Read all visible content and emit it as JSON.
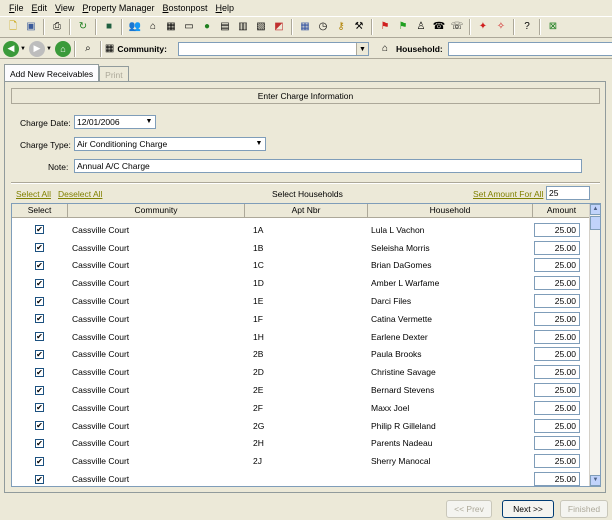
{
  "menu": [
    "File",
    "Edit",
    "View",
    "Property Manager",
    "Bostonpost",
    "Help"
  ],
  "nav": {
    "community_label": "Community:",
    "community_value": "",
    "household_label": "Household:",
    "household_value": ""
  },
  "tabs": [
    {
      "label": "Add New Receivables"
    },
    {
      "label": "Print"
    }
  ],
  "form": {
    "header": "Enter Charge Information",
    "charge_date_label": "Charge Date:",
    "charge_date": "12/01/2006",
    "charge_type_label": "Charge Type:",
    "charge_type": "Air Conditioning Charge",
    "note_label": "Note:",
    "note": "Annual A/C Charge"
  },
  "selection": {
    "select_all": "Select All",
    "deselect_all": "Deselect All",
    "title": "Select Households",
    "set_amount_label": "Set Amount For All",
    "set_amount_value": "25"
  },
  "table": {
    "headers": [
      "Select",
      "Community",
      "Apt Nbr",
      "Household",
      "Amount"
    ],
    "rows": [
      {
        "checked": true,
        "community": "Cassville Court",
        "apt": "1A",
        "household": "Lula L Vachon",
        "amount": "25.00"
      },
      {
        "checked": true,
        "community": "Cassville Court",
        "apt": "1B",
        "household": "Seleisha Morris",
        "amount": "25.00"
      },
      {
        "checked": true,
        "community": "Cassville Court",
        "apt": "1C",
        "household": "Brian DaGomes",
        "amount": "25.00"
      },
      {
        "checked": true,
        "community": "Cassville Court",
        "apt": "1D",
        "household": "Amber L Warfame",
        "amount": "25.00"
      },
      {
        "checked": true,
        "community": "Cassville Court",
        "apt": "1E",
        "household": "Darci Files",
        "amount": "25.00"
      },
      {
        "checked": true,
        "community": "Cassville Court",
        "apt": "1F",
        "household": "Catina Vermette",
        "amount": "25.00"
      },
      {
        "checked": true,
        "community": "Cassville Court",
        "apt": "1H",
        "household": "Earlene Dexter",
        "amount": "25.00"
      },
      {
        "checked": true,
        "community": "Cassville Court",
        "apt": "2B",
        "household": "Paula Brooks",
        "amount": "25.00"
      },
      {
        "checked": true,
        "community": "Cassville Court",
        "apt": "2D",
        "household": "Christine Savage",
        "amount": "25.00"
      },
      {
        "checked": true,
        "community": "Cassville Court",
        "apt": "2E",
        "household": "Bernard Stevens",
        "amount": "25.00"
      },
      {
        "checked": true,
        "community": "Cassville Court",
        "apt": "2F",
        "household": "Maxx Joel",
        "amount": "25.00"
      },
      {
        "checked": true,
        "community": "Cassville Court",
        "apt": "2G",
        "household": "Philip R Gilleland",
        "amount": "25.00"
      },
      {
        "checked": true,
        "community": "Cassville Court",
        "apt": "2H",
        "household": "Parents Nadeau",
        "amount": "25.00"
      },
      {
        "checked": true,
        "community": "Cassville Court",
        "apt": "2J",
        "household": "Sherry Manocal",
        "amount": "25.00"
      },
      {
        "checked": true,
        "community": "Cassville Court",
        "apt": "",
        "household": "",
        "amount": "25.00"
      }
    ]
  },
  "buttons": {
    "prev": "<< Prev",
    "next": "Next >>",
    "finished": "Finished"
  }
}
